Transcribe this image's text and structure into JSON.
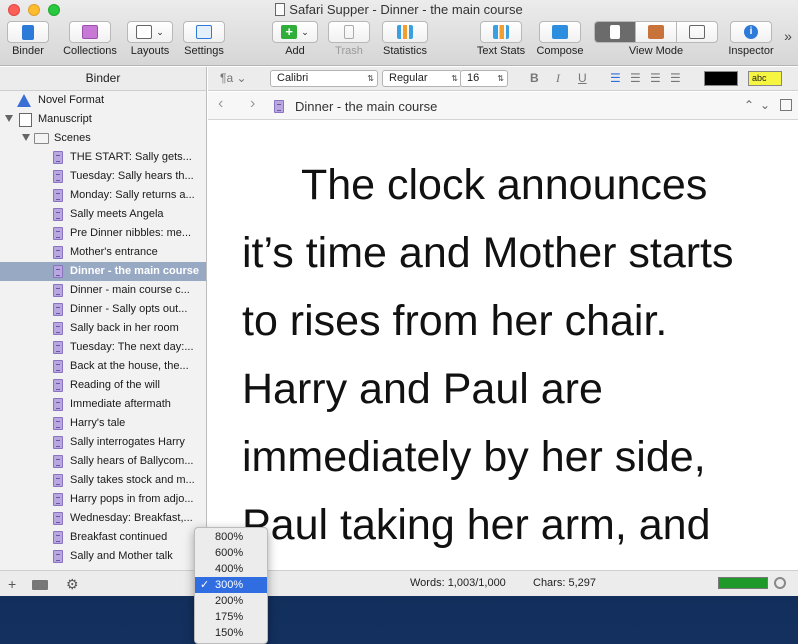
{
  "window": {
    "title": "Safari Supper - Dinner - the main course"
  },
  "toolbar": {
    "binder": "Binder",
    "collections": "Collections",
    "layouts": "Layouts",
    "settings": "Settings",
    "add": "Add",
    "trash": "Trash",
    "statistics": "Statistics",
    "text_stats": "Text Stats",
    "compose": "Compose",
    "view_mode": "View Mode",
    "inspector": "Inspector",
    "overflow": "»"
  },
  "binder": {
    "header": "Binder",
    "items": [
      {
        "label": "Novel Format"
      },
      {
        "label": "Manuscript"
      },
      {
        "label": "Scenes"
      },
      {
        "label": "THE START: Sally gets..."
      },
      {
        "label": "Tuesday: Sally hears th..."
      },
      {
        "label": "Monday: Sally returns a..."
      },
      {
        "label": "Sally meets Angela"
      },
      {
        "label": "Pre Dinner nibbles: me..."
      },
      {
        "label": "Mother's entrance"
      },
      {
        "label": "Dinner - the main course"
      },
      {
        "label": "Dinner - main course c..."
      },
      {
        "label": "Dinner - Sally opts out..."
      },
      {
        "label": "Sally back in her room"
      },
      {
        "label": "Tuesday: The next day:..."
      },
      {
        "label": "Back at the house, the..."
      },
      {
        "label": "Reading of the will"
      },
      {
        "label": "Immediate aftermath"
      },
      {
        "label": "Harry's tale"
      },
      {
        "label": "Sally interrogates Harry"
      },
      {
        "label": "Sally hears of Ballycom..."
      },
      {
        "label": "Sally takes stock and m..."
      },
      {
        "label": "Harry pops in from adjo..."
      },
      {
        "label": "Wednesday: Breakfast,..."
      },
      {
        "label": "Breakfast continued"
      },
      {
        "label": "Sally and Mother talk"
      }
    ],
    "selected_index": 9
  },
  "format": {
    "style_icon": "¶a",
    "font": "Calibri",
    "weight": "Regular",
    "size": "16",
    "bold": "B",
    "italic": "I",
    "underline": "U",
    "highlight": "abc"
  },
  "navbar": {
    "title": "Dinner - the main course"
  },
  "editor": {
    "lines": [
      "     The clock announces",
      "it’s time and Mother starts",
      "to rises from her chair.",
      "Harry and Paul are",
      "immediately by her side,",
      "Paul taking her arm, and"
    ]
  },
  "status": {
    "words": "Words: 1,003/1,000",
    "chars": "Chars: 5,297",
    "progress_fraction": 1.0
  },
  "zoom_menu": {
    "options": [
      "800%",
      "600%",
      "400%",
      "300%",
      "200%",
      "175%",
      "150%"
    ],
    "selected": "300%",
    "check": "✓"
  },
  "colors": {
    "selection": "#98a9c4",
    "accent": "#2f6de1",
    "progress": "#1f9a2a",
    "highlight_yellow": "#f5f542"
  }
}
